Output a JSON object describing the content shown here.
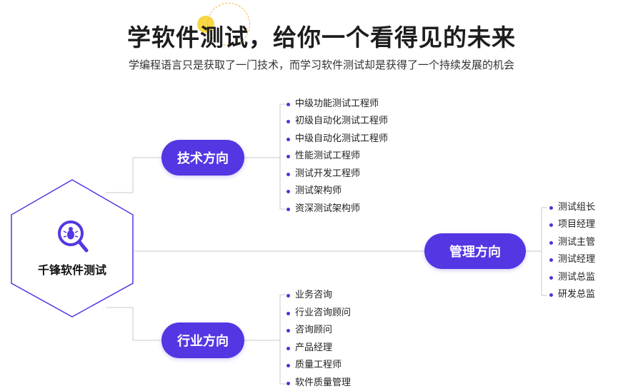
{
  "header": {
    "title": "学软件测试，给你一个看得见的未来",
    "subtitle": "学编程语言只是获取了一门技术，而学习软件测试却是获得了一个持续发展的机会"
  },
  "root": {
    "label": "千锋软件测试",
    "icon": "search-bug-icon"
  },
  "branches": {
    "tech": {
      "label": "技术方向",
      "items": [
        "中级功能测试工程师",
        "初级自动化测试工程师",
        "中级自动化测试工程师",
        "性能测试工程师",
        "测试开发工程师",
        "测试架构师",
        "资深测试架构师"
      ]
    },
    "management": {
      "label": "管理方向",
      "items": [
        "测试组长",
        "项目经理",
        "测试主管",
        "测试经理",
        "测试总监",
        "研发总监"
      ]
    },
    "industry": {
      "label": "行业方向",
      "items": [
        "业务咨询",
        "行业咨询顾问",
        "咨询顾问",
        "产品经理",
        "质量工程师",
        "软件质量管理"
      ]
    }
  },
  "colors": {
    "accent": "#5436e3",
    "line": "#c9c9c9",
    "deco_yellow": "#f8d43a"
  }
}
